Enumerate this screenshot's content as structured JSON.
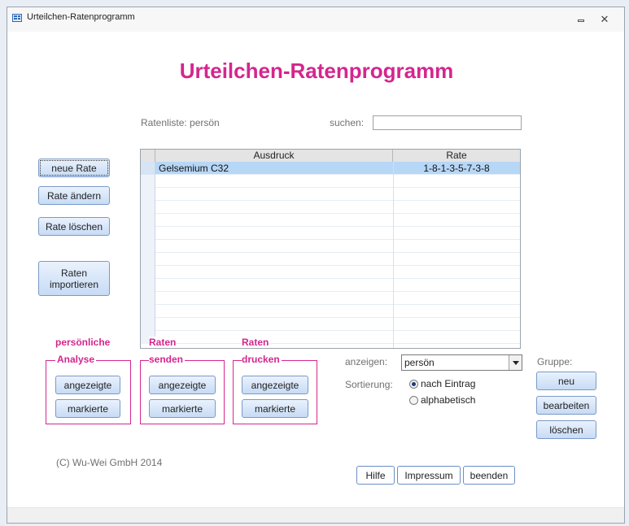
{
  "window": {
    "title": "Urteilchen-Ratenprogramm",
    "close_glyph": "✕"
  },
  "heading": "Urteilchen-Ratenprogramm",
  "list": {
    "label": "Ratenliste: persön",
    "search_label": "suchen:",
    "search_value": "",
    "columns": [
      "Ausdruck",
      "Rate"
    ],
    "rows": [
      {
        "ausdruck": "Gelsemium C32",
        "rate": "1-8-1-3-5-7-3-8"
      }
    ]
  },
  "left_buttons": {
    "new": "neue Rate",
    "edit": "Rate ändern",
    "delete": "Rate löschen",
    "import_line1": "Raten",
    "import_line2": "importieren"
  },
  "groups": {
    "analyse": {
      "title_line1": "persönliche",
      "title_line2": "Analyse",
      "btn1": "angezeigte",
      "btn2": "markierte"
    },
    "senden": {
      "title_line1": "Raten",
      "title_line2": "senden",
      "btn1": "angezeigte",
      "btn2": "markierte"
    },
    "drucken": {
      "title_line1": "Raten",
      "title_line2": "drucken",
      "btn1": "angezeigte",
      "btn2": "markierte"
    }
  },
  "filter": {
    "show_label": "anzeigen:",
    "show_value": "persön",
    "sort_label": "Sortierung:",
    "sort_options": [
      "nach Eintrag",
      "alphabetisch"
    ],
    "sort_selected": 0
  },
  "gruppe": {
    "label": "Gruppe:",
    "new": "neu",
    "edit": "bearbeiten",
    "delete": "löschen"
  },
  "footer": {
    "copyright": "(C) Wu-Wei GmbH 2014",
    "help": "Hilfe",
    "impressum": "Impressum",
    "exit": "beenden"
  },
  "colors": {
    "accent": "#d4268e",
    "selection": "#b7d7f7",
    "button": "#c7dbf5"
  }
}
